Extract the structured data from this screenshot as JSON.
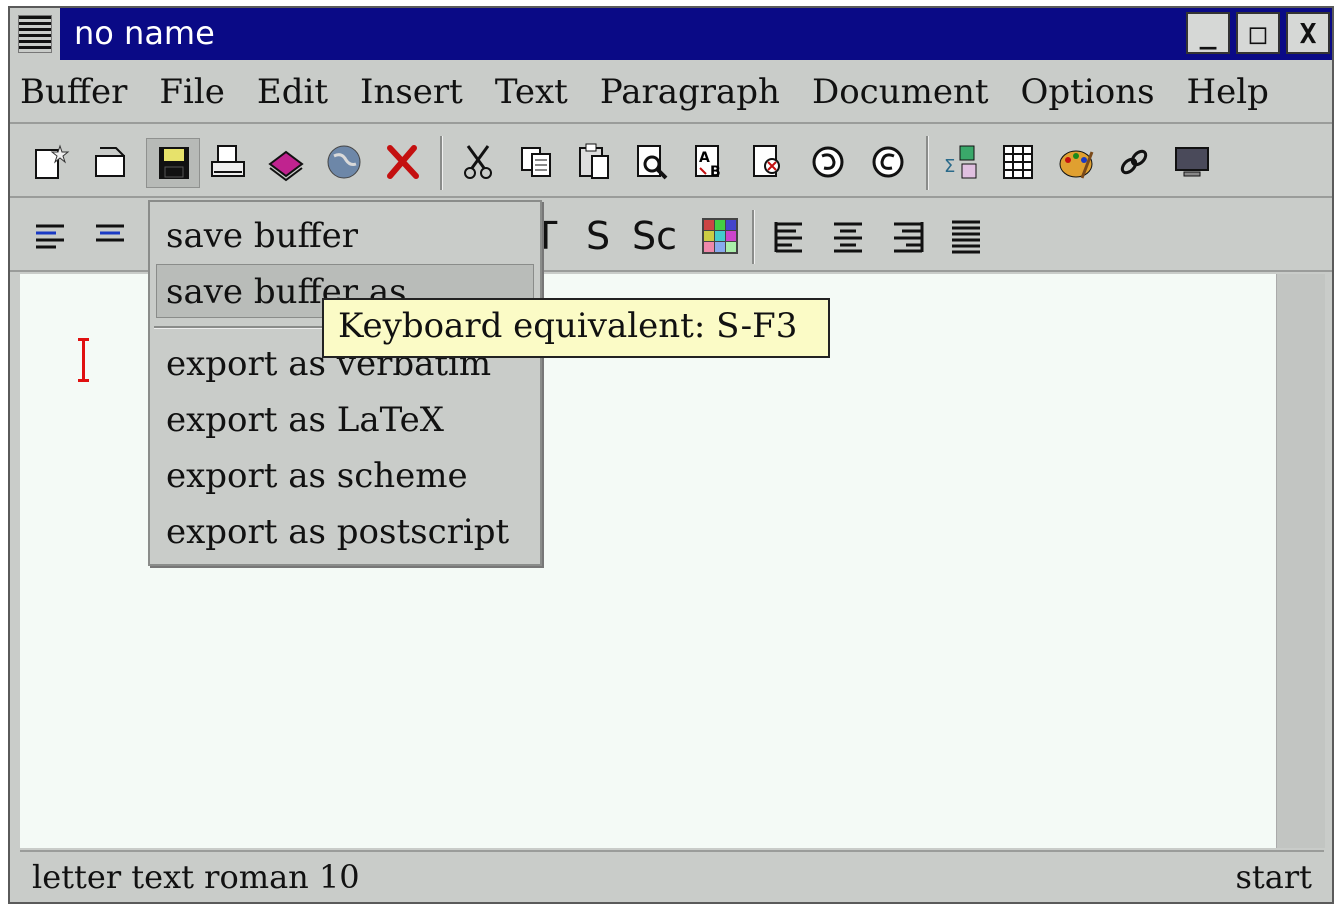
{
  "window": {
    "title": "no name"
  },
  "titlebar_buttons": [
    {
      "name": "minimize",
      "glyph": "_"
    },
    {
      "name": "maximize",
      "glyph": "□"
    },
    {
      "name": "close",
      "glyph": "X"
    }
  ],
  "menubar": {
    "items": [
      "Buffer",
      "File",
      "Edit",
      "Insert",
      "Text",
      "Paragraph",
      "Document",
      "Options",
      "Help"
    ]
  },
  "toolbar1": {
    "icons": [
      "new-document-icon",
      "open-icon",
      "save-icon",
      "print-icon",
      "books-icon",
      "globe-icon",
      "close-x-icon",
      "cut-icon",
      "copy-icon",
      "paste-icon",
      "find-icon",
      "replace-icon",
      "spell-icon",
      "undo-icon",
      "redo-icon",
      "formula-icon",
      "table-icon",
      "palette-icon",
      "link-icon",
      "monitor-icon"
    ]
  },
  "toolbar2": {
    "icons": [
      "align-left-icon",
      "align-center-icon"
    ],
    "text_buttons": [
      "T",
      "S",
      "Sc"
    ],
    "extra_icons": [
      "color-palette-icon",
      "para-left-icon",
      "para-center-icon",
      "para-right-icon",
      "para-justify-icon"
    ]
  },
  "dropdown": {
    "items": [
      "save buffer",
      "save buffer as",
      "export as verbatim",
      "export as LaTeX",
      "export as scheme",
      "export as postscript"
    ],
    "highlighted": "save buffer as"
  },
  "tooltip": {
    "text": "Keyboard equivalent: S-F3"
  },
  "statusbar": {
    "left": "letter text roman 10",
    "right": "start"
  },
  "colors": {
    "titlebar": "#0a0a86",
    "chrome": "#c9ccc9",
    "editor_bg": "#f4faf6",
    "tooltip_bg": "#fbfbc6",
    "cursor": "#e01010"
  }
}
